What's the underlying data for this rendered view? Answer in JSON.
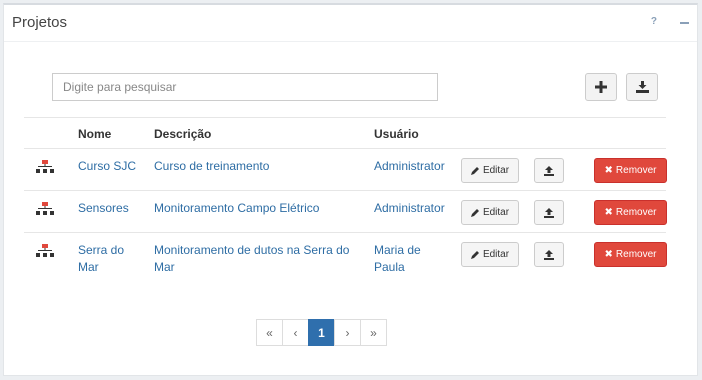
{
  "panel": {
    "title": "Projetos",
    "help_label": "?"
  },
  "search": {
    "placeholder": "Digite para pesquisar"
  },
  "toolbar": {
    "add_icon": "plus-icon",
    "import_icon": "download-tray-icon"
  },
  "table": {
    "headers": {
      "name": "Nome",
      "description": "Descrição",
      "user": "Usuário"
    },
    "rows": [
      {
        "name": "Curso SJC",
        "description": "Curso de treinamento",
        "user": "Administrator"
      },
      {
        "name": "Sensores",
        "description": "Monitoramento Campo Elétrico",
        "user": "Administrator"
      },
      {
        "name": "Serra do Mar",
        "description": "Monitoramento de dutos na Serra do Mar",
        "user": "Maria de Paula"
      }
    ],
    "edit_label": "Editar",
    "remove_label": "Remover"
  },
  "pagination": {
    "first": "«",
    "prev": "‹",
    "current": "1",
    "next": "›",
    "last": "»"
  },
  "colors": {
    "link": "#2e6da4",
    "danger": "#e0483c",
    "primary": "#2f6fad",
    "project_icon": "#e0483c"
  }
}
